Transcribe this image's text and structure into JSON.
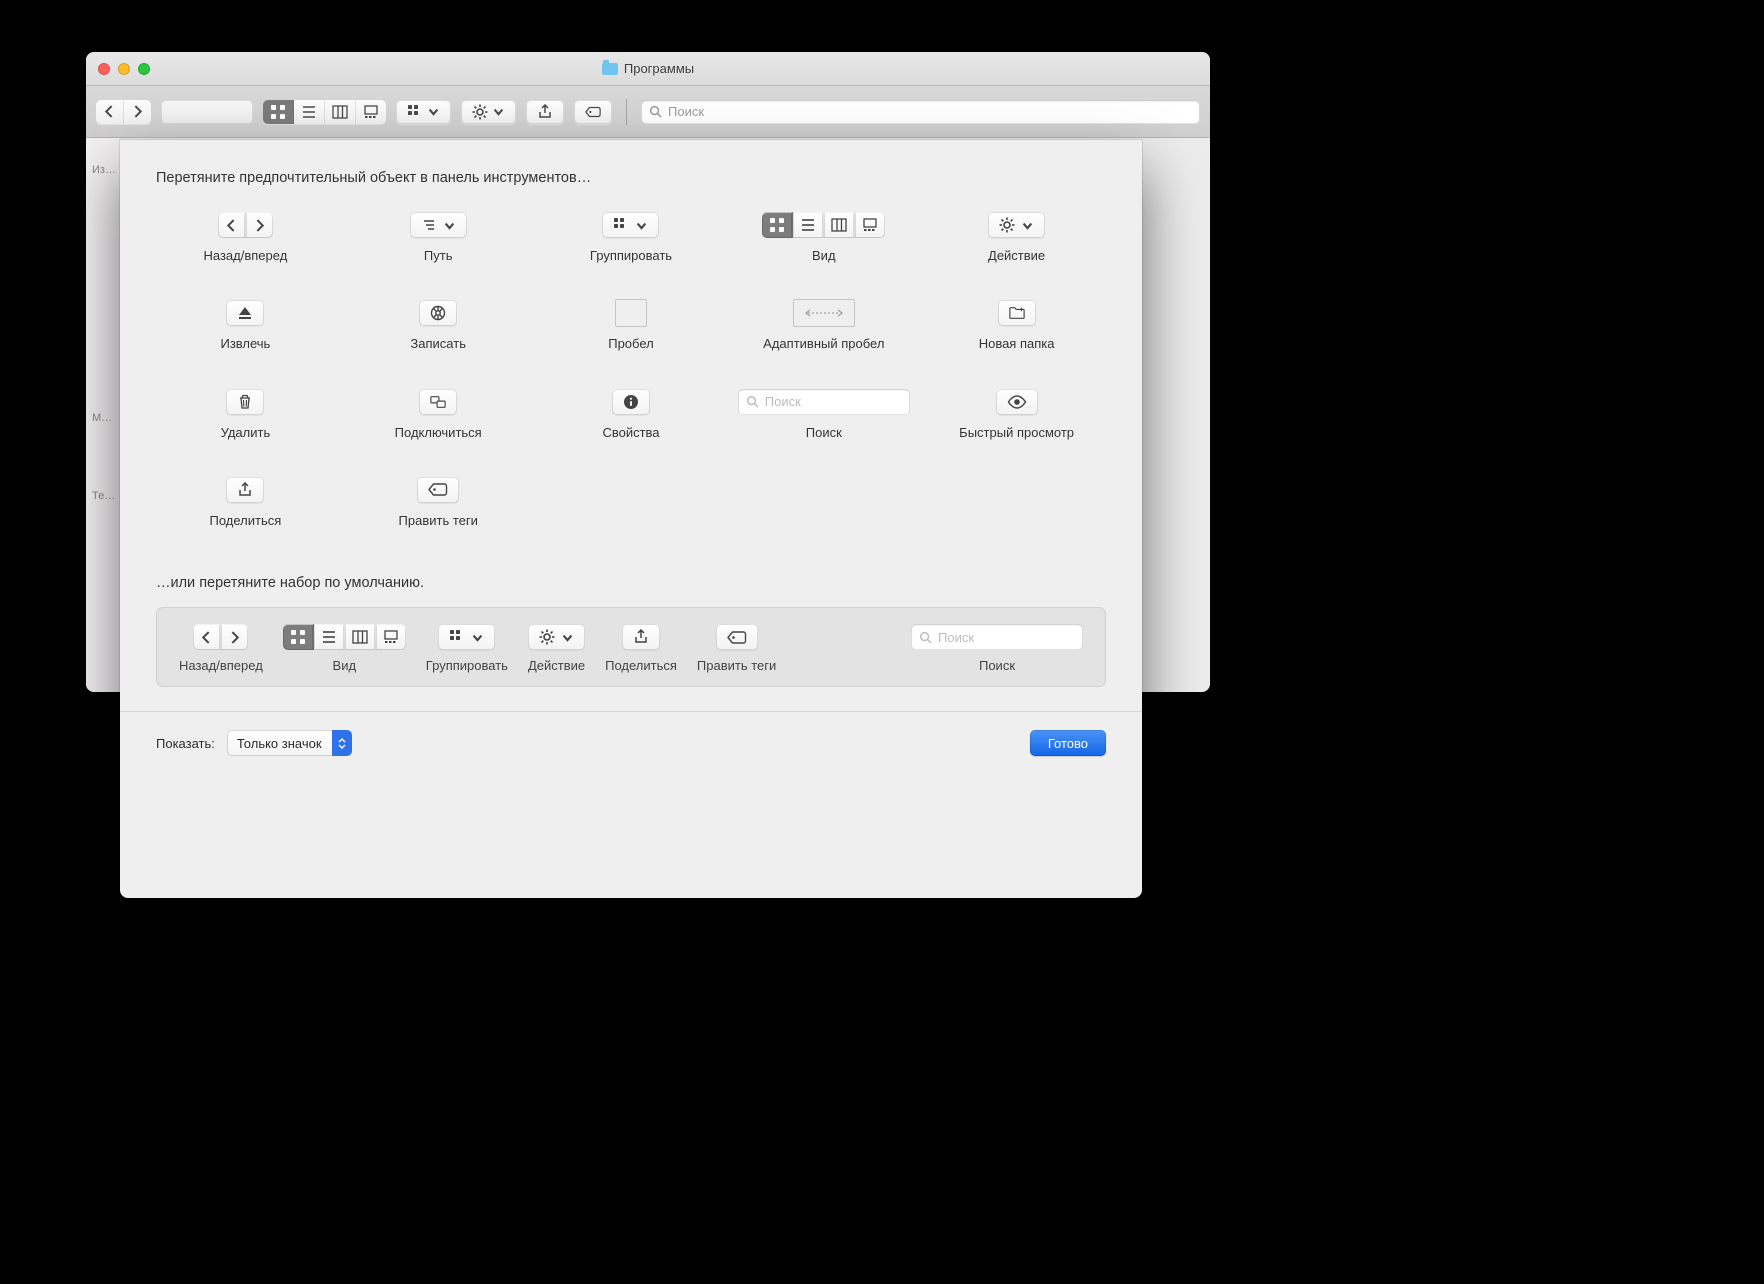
{
  "window": {
    "title": "Программы"
  },
  "toolbar": {
    "search_placeholder": "Поиск"
  },
  "sidebar": {
    "sections": [
      "Из…",
      "М…",
      "Те…"
    ]
  },
  "sheet": {
    "heading": "Перетяните предпочтительный объект в панель инструментов…",
    "subheading": "…или перетяните набор по умолчанию.",
    "items": {
      "back_forward": "Назад/вперед",
      "path": "Путь",
      "group": "Группировать",
      "view": "Вид",
      "action": "Действие",
      "eject": "Извлечь",
      "burn": "Записать",
      "space": "Пробел",
      "flex_space": "Адаптивный пробел",
      "new_folder": "Новая папка",
      "delete": "Удалить",
      "connect": "Подключиться",
      "get_info": "Свойства",
      "search": "Поиск",
      "search_placeholder": "Поиск",
      "quicklook": "Быстрый просмотр",
      "share": "Поделиться",
      "tags": "Править теги"
    },
    "default_set": {
      "back_forward": "Назад/вперед",
      "view": "Вид",
      "group": "Группировать",
      "action": "Действие",
      "share": "Поделиться",
      "tags": "Править теги",
      "search": "Поиск",
      "search_placeholder": "Поиск"
    },
    "footer": {
      "show_label": "Показать:",
      "show_value": "Только значок",
      "done": "Готово"
    }
  }
}
